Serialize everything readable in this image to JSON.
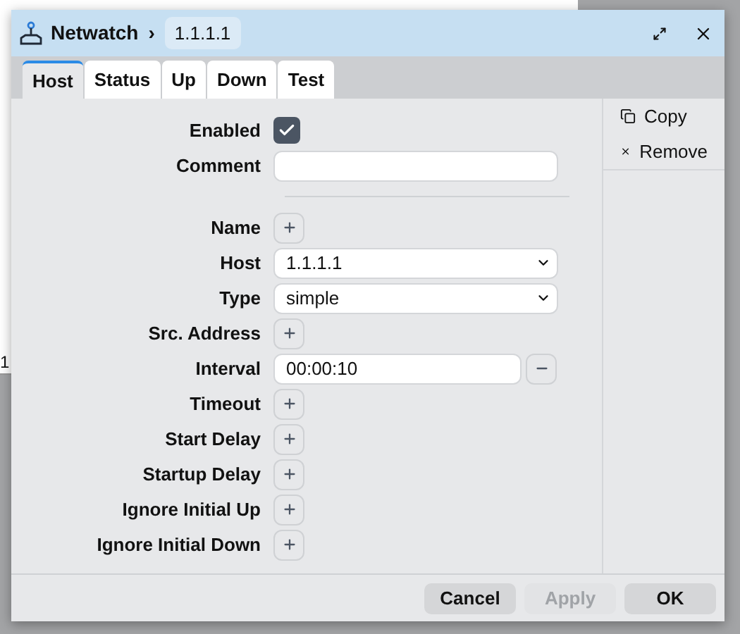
{
  "background": {
    "edge_text": "1"
  },
  "window": {
    "title": "Netwatch",
    "breadcrumb": "›",
    "item": "1.1.1.1"
  },
  "tabs": [
    {
      "label": "Host",
      "selected": true
    },
    {
      "label": "Status",
      "selected": false
    },
    {
      "label": "Up",
      "selected": false
    },
    {
      "label": "Down",
      "selected": false
    },
    {
      "label": "Test",
      "selected": false
    }
  ],
  "fields_top": [
    {
      "kind": "checkbox",
      "label": "Enabled",
      "checked": true
    },
    {
      "kind": "text",
      "label": "Comment"
    }
  ],
  "fields": [
    {
      "kind": "add",
      "label": "Name"
    },
    {
      "kind": "select",
      "label": "Host",
      "value": "1.1.1.1"
    },
    {
      "kind": "select",
      "label": "Type",
      "value": "simple"
    },
    {
      "kind": "add",
      "label": "Src. Address"
    },
    {
      "kind": "removable",
      "label": "Interval",
      "value": "00:00:10"
    },
    {
      "kind": "add",
      "label": "Timeout"
    },
    {
      "kind": "add",
      "label": "Start Delay"
    },
    {
      "kind": "add",
      "label": "Startup Delay"
    },
    {
      "kind": "add",
      "label": "Ignore Initial Up"
    },
    {
      "kind": "add",
      "label": "Ignore Initial Down"
    }
  ],
  "actions": [
    {
      "kind": "copy",
      "label": "Copy"
    },
    {
      "kind": "remove",
      "label": "Remove"
    }
  ],
  "buttons": [
    {
      "label": "Cancel",
      "disabled": false
    },
    {
      "label": "Apply",
      "disabled": true
    },
    {
      "label": "OK",
      "disabled": false
    }
  ]
}
